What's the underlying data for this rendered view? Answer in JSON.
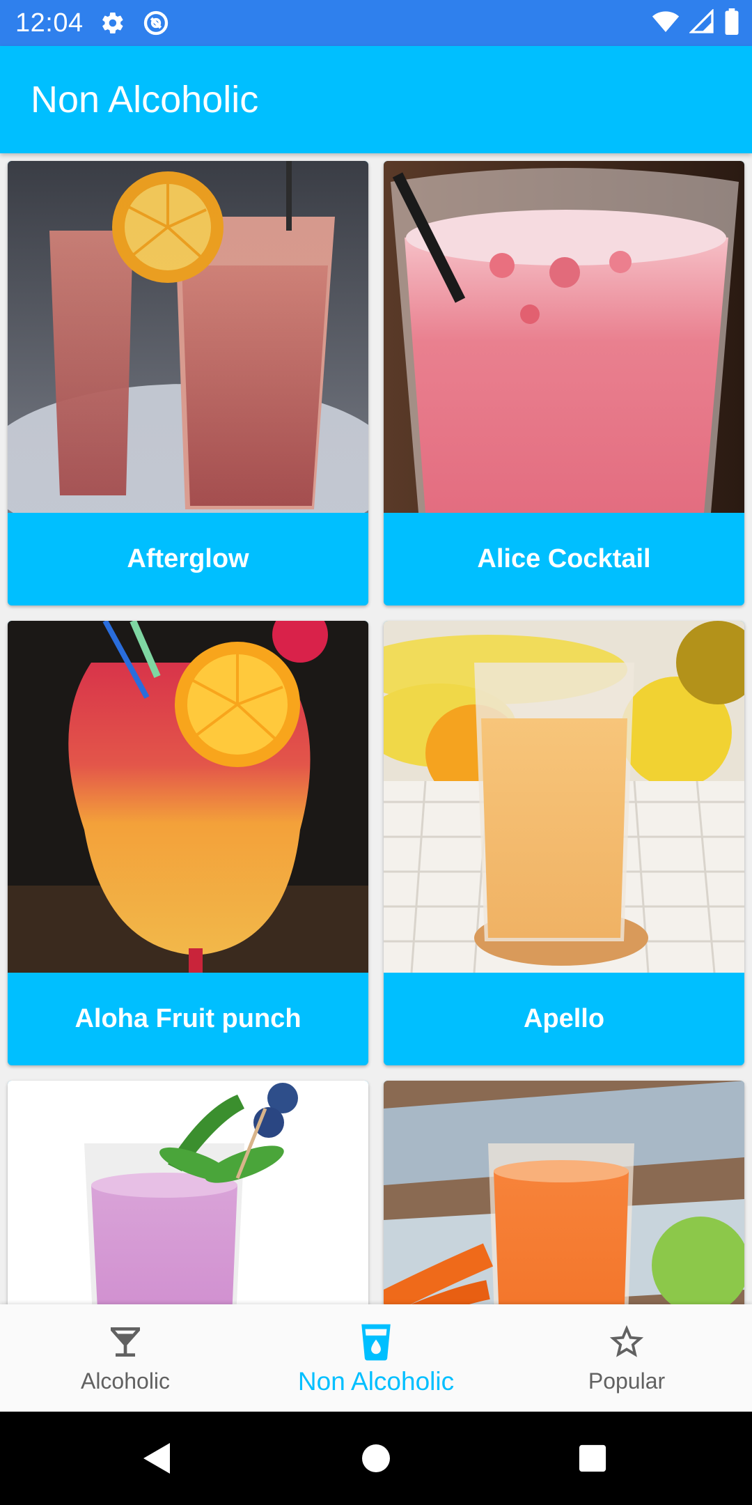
{
  "status_bar": {
    "time": "12:04",
    "icons": [
      "gear-icon",
      "data-saver-icon",
      "wifi-icon",
      "cell-signal-icon",
      "battery-icon"
    ]
  },
  "app_bar": {
    "title": "Non Alcoholic"
  },
  "colors": {
    "accent": "#00bfff",
    "status_bar": "#2f80ed",
    "nav_inactive": "#616161"
  },
  "drinks": [
    {
      "name": "Afterglow"
    },
    {
      "name": "Alice Cocktail"
    },
    {
      "name": "Aloha Fruit punch"
    },
    {
      "name": "Apello"
    },
    {
      "name": ""
    },
    {
      "name": ""
    }
  ],
  "bottom_nav": {
    "items": [
      {
        "label": "Alcoholic",
        "icon": "cocktail-glass-icon",
        "active": false
      },
      {
        "label": "Non Alcoholic",
        "icon": "cup-drop-icon",
        "active": true
      },
      {
        "label": "Popular",
        "icon": "star-icon",
        "active": false
      }
    ]
  },
  "system_nav": [
    "back-icon",
    "home-icon",
    "recents-icon"
  ]
}
